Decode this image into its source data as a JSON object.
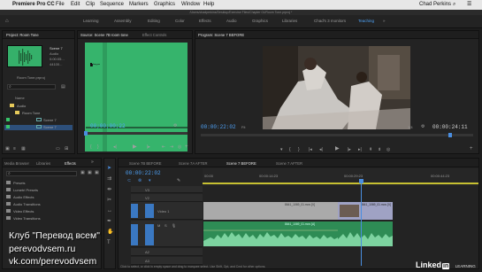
{
  "menubar": {
    "app": "Premiere Pro CC",
    "items": [
      "File",
      "Edit",
      "Clip",
      "Sequence",
      "Markers",
      "Graphics",
      "Window",
      "Help"
    ],
    "user": "Chad Perkins"
  },
  "title_path": "/Users/chadperkins/Desktop/Exercise Files/Chapter 01/Room Tone.prproj *",
  "workspaces": [
    "Learning",
    "Assembly",
    "Editing",
    "Color",
    "Effects",
    "Audio",
    "Graphics",
    "Libraries",
    "Chad's 3 monitors",
    "Teaching"
  ],
  "active_workspace": "Teaching",
  "project": {
    "tab": "Project: Room Tone",
    "media_name": "Scene 7",
    "media_lines": [
      "Audio",
      "0:00:05...",
      "44100..."
    ],
    "project_file": "Room Tone.prproj",
    "column_name": "Name",
    "bins": [
      "Audio",
      "Room Tone",
      "Scene 7",
      "Scene 7"
    ]
  },
  "source": {
    "tab": "Source: Scene 7B room tone",
    "tab2": "Effect Controls",
    "timecode": "00;00;00;22"
  },
  "program": {
    "tab": "Program: Scene 7 BEFORE",
    "timecode": "00:00:22:02",
    "fit": "Fit",
    "ratio": "1/4",
    "duration": "00:00:24:11"
  },
  "effects": {
    "tabs": [
      "Media Browser",
      "Libraries",
      "Effects"
    ],
    "items": [
      "Presets",
      "Lumetri Presets",
      "Audio Effects",
      "Audio Transitions",
      "Video Effects",
      "Video Transitions"
    ]
  },
  "timeline": {
    "tabs": [
      "Scene 7B BEFORE",
      "Scene 7A AFTER",
      "Scene 7 BEFORE",
      "Scene 7 AFTER"
    ],
    "active_tab": "Scene 7 BEFORE",
    "timecode": "00:00:22:02",
    "ruler": [
      "00:00",
      "00:00:14:23",
      "00:00:29:23",
      "00:00:44:23"
    ],
    "tracks": [
      "V3",
      "V2",
      "V1",
      "A1",
      "A2",
      "A3"
    ],
    "track_label": "Video 1",
    "clip_v1": "8641_1069_01.mov [V]",
    "clip_v1b": "8641_1069_01.mov [V]",
    "clip_a1": "8641_1069_01.mov [A]",
    "status": "Click to select, or click in empty space and drag to marquee select. Use Shift, Opt, and Cmd for other options."
  },
  "watermark": {
    "line1": "Клуб \"Перевод всем\"",
    "line2": "perevodvsem.ru",
    "line3": "vk.com/perevodvsem"
  },
  "brand": {
    "name": "Linked",
    "badge": "in",
    "sub": "LEARNING"
  }
}
